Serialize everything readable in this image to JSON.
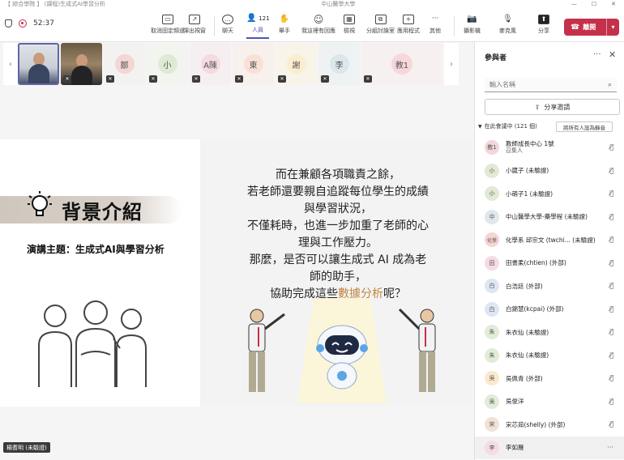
{
  "window": {
    "title": "【 綜合學院 】 (課程)生成式AI學習分析",
    "org": "中山醫學大學"
  },
  "call": {
    "timer": "52:37"
  },
  "toolbar": {
    "items": [
      {
        "label": "取消固定頻道",
        "icon": "▭"
      },
      {
        "label": "彈出視窗",
        "icon": "↗"
      },
      {
        "label": "聊天",
        "icon": "…"
      },
      {
        "label": "人員",
        "icon": "👤",
        "count": "121"
      },
      {
        "label": "舉手",
        "icon": "✋"
      },
      {
        "label": "我這裡有回應",
        "icon": "☺"
      },
      {
        "label": "檢視",
        "icon": "▦"
      },
      {
        "label": "分組討論室",
        "icon": "⧉"
      },
      {
        "label": "應用程式",
        "icon": "+"
      },
      {
        "label": "其他",
        "icon": "···"
      },
      {
        "label": "攝影機",
        "icon": "📷"
      },
      {
        "label": "麥克風",
        "icon": "🎙"
      },
      {
        "label": "分享",
        "icon": "⬆"
      }
    ],
    "leave_label": "離開"
  },
  "thumbnails": [
    {
      "kind": "video1"
    },
    {
      "kind": "video2"
    },
    {
      "initial": "鄒",
      "color": "#f2d7d5"
    },
    {
      "initial": "小",
      "color": "#dfe9d3"
    },
    {
      "initial": "A陳",
      "color": "#f5dadf"
    },
    {
      "initial": "東",
      "color": "#f9e0d4"
    },
    {
      "initial": "謝",
      "color": "#fbeed0"
    },
    {
      "initial": "李",
      "color": "#dbe7ea"
    },
    {
      "initial": "",
      "color": "#f0f0f0"
    },
    {
      "initial": "教1",
      "color": "#f6d7da"
    }
  ],
  "slide": {
    "title": "背景介紹",
    "subtitle": "演講主題：生成式AI與學習分析",
    "body_lines": [
      "而在兼顧各項職責之餘，",
      "若老師還要親自追蹤每位學生的成績",
      "與學習狀況，",
      "不僅耗時，也進一步加重了老師的心",
      "理與工作壓力。",
      "那麼，是否可以讓生成式 AI 成為老",
      "師的助手，"
    ],
    "last_line_pre": "協助完成這些",
    "last_line_highlight": "數據分析",
    "last_line_post": "呢？"
  },
  "speaker_tag": "楊耆明 (未驗證)",
  "panel": {
    "title": "參與者",
    "search_placeholder": "輸入名稱",
    "share_invite": "分享邀請",
    "section_label": "在此會議中 (121 個)",
    "mute_all": "將所有人設為靜音",
    "participants": [
      {
        "avatar": "教1",
        "name": "教師成長中心 1號",
        "role": "召集人",
        "color": "#f3d6d9"
      },
      {
        "avatar": "小",
        "name": "小葳子 (未驗證)",
        "role": "",
        "color": "#e2ead6"
      },
      {
        "avatar": "小",
        "name": "小萌子1 (未驗證)",
        "role": "",
        "color": "#e2ead6"
      },
      {
        "avatar": "中",
        "name": "中山醫學大學-藥學程 (未驗證)",
        "role": "",
        "color": "#dfe8ec"
      },
      {
        "avatar": "化學",
        "name": "化學系 邱宗文 (twchi... (未驗證)",
        "role": "",
        "color": "#f6d5d2"
      },
      {
        "avatar": "田",
        "name": "田書柔(chtien) (外部)",
        "role": "",
        "color": "#f5dbe4"
      },
      {
        "avatar": "白",
        "name": "白浩廷 (外部)",
        "role": "",
        "color": "#dde6f2"
      },
      {
        "avatar": "白",
        "name": "白錦慧(kcpai) (外部)",
        "role": "",
        "color": "#dde6f2"
      },
      {
        "avatar": "朱",
        "name": "朱衣仙 (未驗證)",
        "role": "",
        "color": "#e1ecd9"
      },
      {
        "avatar": "朱",
        "name": "朱衣仙 (未驗證)",
        "role": "",
        "color": "#e1ecd9"
      },
      {
        "avatar": "吳",
        "name": "吳佩青 (外部)",
        "role": "",
        "color": "#fbe9cd"
      },
      {
        "avatar": "吳",
        "name": "吳俊洋",
        "role": "",
        "color": "#e1ecd9"
      },
      {
        "avatar": "宋",
        "name": "宋芯茹(shelly) (外部)",
        "role": "",
        "color": "#f0e2d6"
      },
      {
        "avatar": "李",
        "name": "李如雁",
        "role": "",
        "color": "#f5dbe4"
      }
    ]
  }
}
